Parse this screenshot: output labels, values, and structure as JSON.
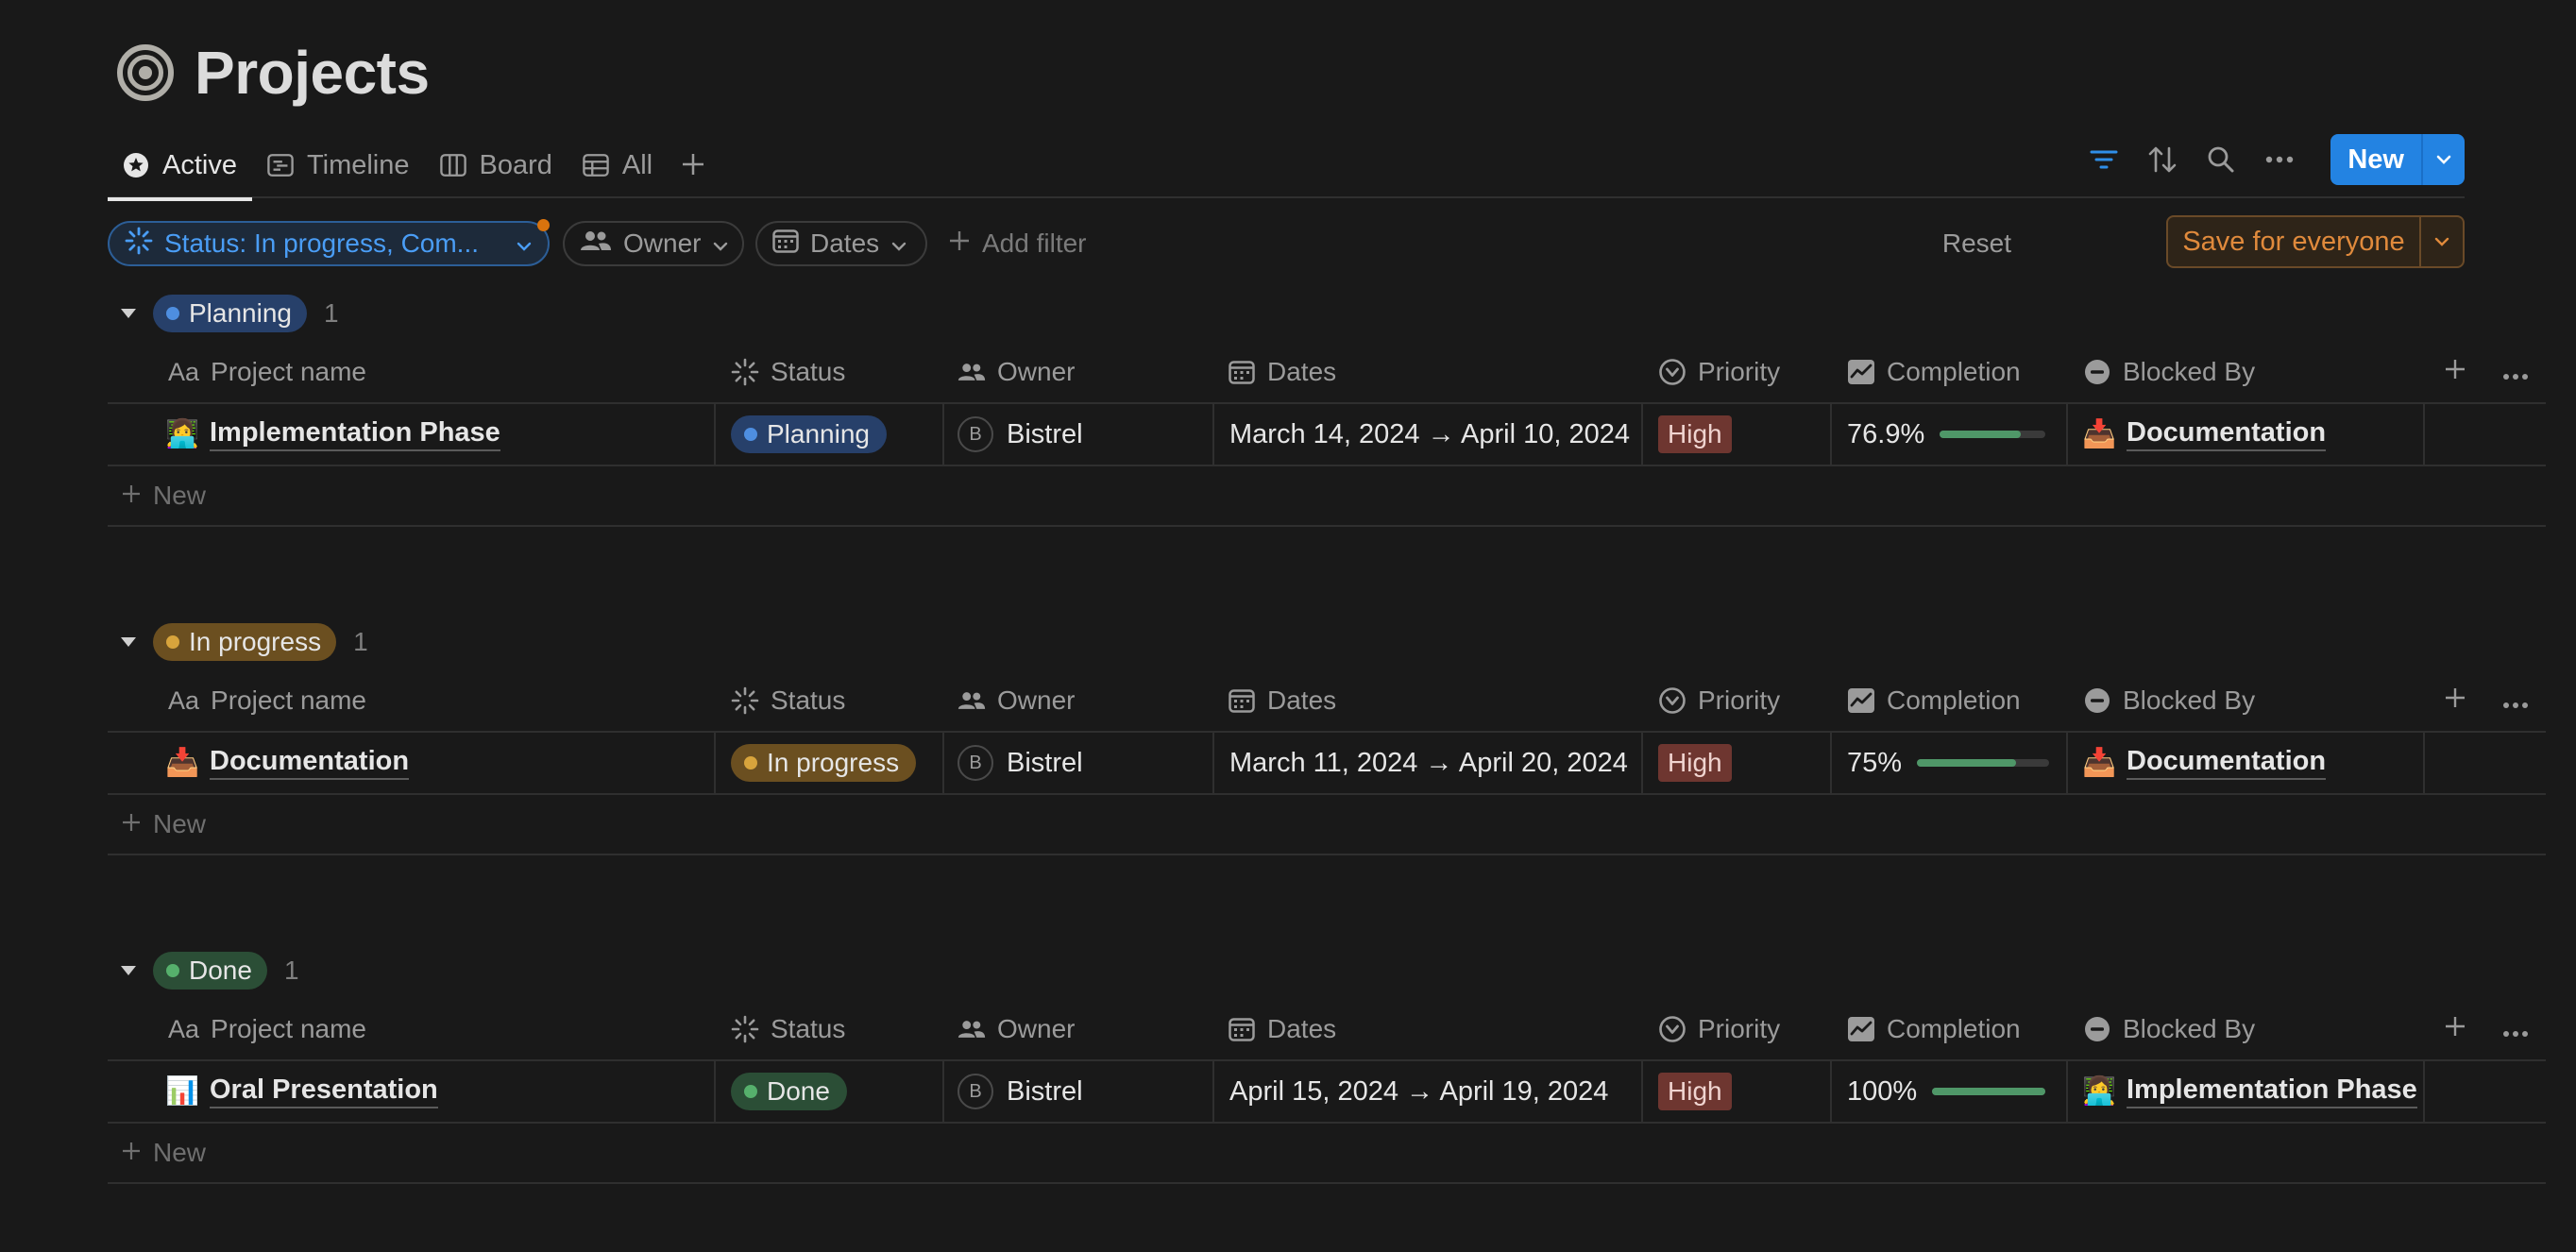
{
  "page": {
    "title": "Projects"
  },
  "tabs": [
    {
      "label": "Active",
      "icon": "star-circle-icon",
      "active": true
    },
    {
      "label": "Timeline",
      "icon": "timeline-icon"
    },
    {
      "label": "Board",
      "icon": "board-icon"
    },
    {
      "label": "All",
      "icon": "table-icon"
    }
  ],
  "toolbar": {
    "new_label": "New",
    "icons": [
      "filter-icon",
      "sort-icon",
      "search-icon",
      "more-icon"
    ]
  },
  "filters": {
    "status_label": "Status: In progress, Com...",
    "owner_label": "Owner",
    "dates_label": "Dates",
    "add_filter_label": "Add filter",
    "reset_label": "Reset",
    "save_label": "Save for everyone"
  },
  "columns": {
    "name": "Project name",
    "name_prefix": "Aa",
    "status": "Status",
    "owner": "Owner",
    "dates": "Dates",
    "priority": "Priority",
    "completion": "Completion",
    "blocked_by": "Blocked By"
  },
  "new_row_label": "New",
  "groups": [
    {
      "label": "Planning",
      "count": "1",
      "row": {
        "name": "Implementation Phase",
        "emoji": "👩‍💻",
        "status": "Planning",
        "owner_initial": "B",
        "owner": "Bistrel",
        "dates": "March 14, 2024 → April 10, 2024",
        "priority": "High",
        "completion": "76.9%",
        "completion_fraction": 0.769,
        "blocked_by": "Documentation",
        "blocked_emoji": "📥"
      }
    },
    {
      "label": "In progress",
      "count": "1",
      "row": {
        "name": "Documentation",
        "emoji": "📥",
        "status": "In progress",
        "owner_initial": "B",
        "owner": "Bistrel",
        "dates": "March 11, 2024 → April 20, 2024",
        "priority": "High",
        "completion": "75%",
        "completion_fraction": 0.75,
        "blocked_by": "Documentation",
        "blocked_emoji": "📥"
      }
    },
    {
      "label": "Done",
      "count": "1",
      "row": {
        "name": "Oral Presentation",
        "emoji": "📊",
        "status": "Done",
        "owner_initial": "B",
        "owner": "Bistrel",
        "dates": "April 15, 2024 → April 19, 2024",
        "priority": "High",
        "completion": "100%",
        "completion_fraction": 1.0,
        "blocked_by": "Implementation Phase",
        "blocked_emoji": "👩‍💻"
      }
    }
  ],
  "colors": {
    "accent": "#2383e2",
    "planning": "#4e8ee0",
    "in_progress": "#d8a43c",
    "done": "#56b06c",
    "priority_high": "#6e3630",
    "progress": "#4f9768"
  }
}
